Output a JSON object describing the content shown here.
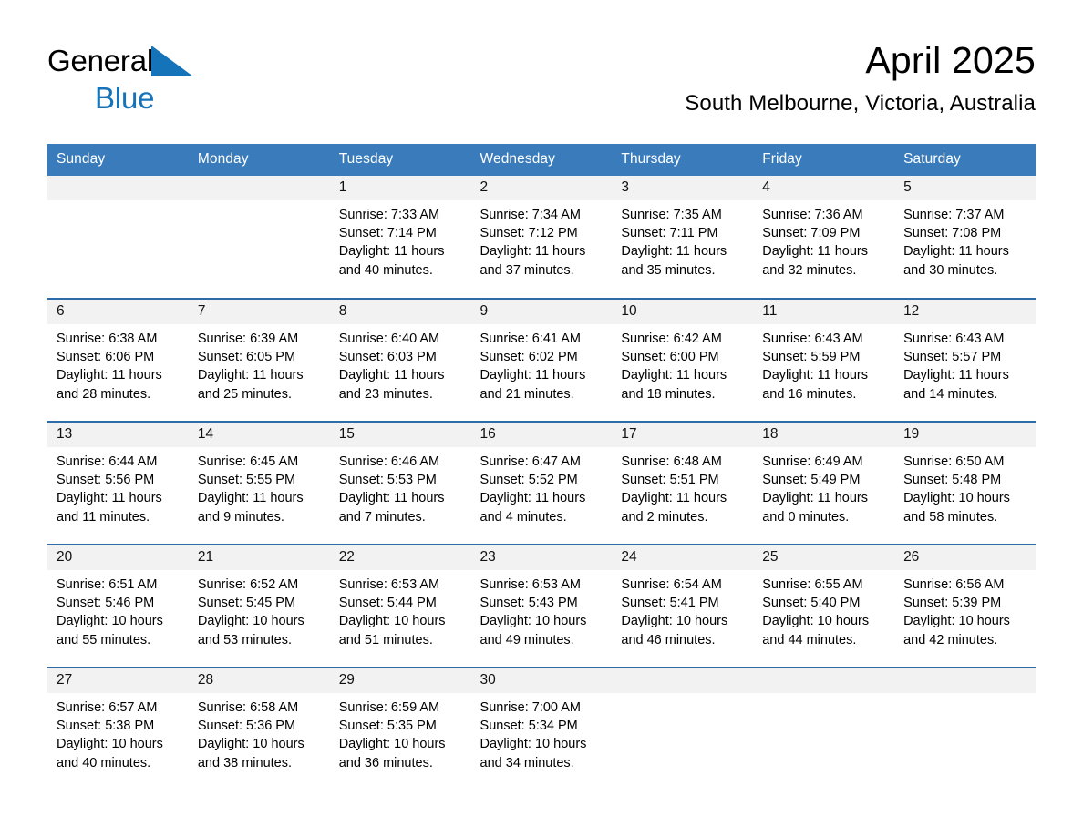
{
  "brand": {
    "name_part1": "General",
    "name_part2": "Blue",
    "triangle_color": "#1573b9"
  },
  "header": {
    "title": "April 2025",
    "subtitle": "South Melbourne, Victoria, Australia"
  },
  "theme": {
    "header_row_bg": "#3a7cbb",
    "week_divider": "#2c6ca8",
    "daynum_bg": "#f2f2f2",
    "text": "#000000"
  },
  "weekday_headers": [
    "Sunday",
    "Monday",
    "Tuesday",
    "Wednesday",
    "Thursday",
    "Friday",
    "Saturday"
  ],
  "labels": {
    "sunrise_prefix": "Sunrise:",
    "sunset_prefix": "Sunset:",
    "daylight_prefix": "Daylight:"
  },
  "weeks": [
    [
      {
        "blank": true,
        "day": ""
      },
      {
        "blank": true,
        "day": ""
      },
      {
        "blank": false,
        "day": "1",
        "sunrise": "Sunrise: 7:33 AM",
        "sunset": "Sunset: 7:14 PM",
        "daylight_l1": "Daylight: 11 hours",
        "daylight_l2": "and 40 minutes."
      },
      {
        "blank": false,
        "day": "2",
        "sunrise": "Sunrise: 7:34 AM",
        "sunset": "Sunset: 7:12 PM",
        "daylight_l1": "Daylight: 11 hours",
        "daylight_l2": "and 37 minutes."
      },
      {
        "blank": false,
        "day": "3",
        "sunrise": "Sunrise: 7:35 AM",
        "sunset": "Sunset: 7:11 PM",
        "daylight_l1": "Daylight: 11 hours",
        "daylight_l2": "and 35 minutes."
      },
      {
        "blank": false,
        "day": "4",
        "sunrise": "Sunrise: 7:36 AM",
        "sunset": "Sunset: 7:09 PM",
        "daylight_l1": "Daylight: 11 hours",
        "daylight_l2": "and 32 minutes."
      },
      {
        "blank": false,
        "day": "5",
        "sunrise": "Sunrise: 7:37 AM",
        "sunset": "Sunset: 7:08 PM",
        "daylight_l1": "Daylight: 11 hours",
        "daylight_l2": "and 30 minutes."
      }
    ],
    [
      {
        "blank": false,
        "day": "6",
        "sunrise": "Sunrise: 6:38 AM",
        "sunset": "Sunset: 6:06 PM",
        "daylight_l1": "Daylight: 11 hours",
        "daylight_l2": "and 28 minutes."
      },
      {
        "blank": false,
        "day": "7",
        "sunrise": "Sunrise: 6:39 AM",
        "sunset": "Sunset: 6:05 PM",
        "daylight_l1": "Daylight: 11 hours",
        "daylight_l2": "and 25 minutes."
      },
      {
        "blank": false,
        "day": "8",
        "sunrise": "Sunrise: 6:40 AM",
        "sunset": "Sunset: 6:03 PM",
        "daylight_l1": "Daylight: 11 hours",
        "daylight_l2": "and 23 minutes."
      },
      {
        "blank": false,
        "day": "9",
        "sunrise": "Sunrise: 6:41 AM",
        "sunset": "Sunset: 6:02 PM",
        "daylight_l1": "Daylight: 11 hours",
        "daylight_l2": "and 21 minutes."
      },
      {
        "blank": false,
        "day": "10",
        "sunrise": "Sunrise: 6:42 AM",
        "sunset": "Sunset: 6:00 PM",
        "daylight_l1": "Daylight: 11 hours",
        "daylight_l2": "and 18 minutes."
      },
      {
        "blank": false,
        "day": "11",
        "sunrise": "Sunrise: 6:43 AM",
        "sunset": "Sunset: 5:59 PM",
        "daylight_l1": "Daylight: 11 hours",
        "daylight_l2": "and 16 minutes."
      },
      {
        "blank": false,
        "day": "12",
        "sunrise": "Sunrise: 6:43 AM",
        "sunset": "Sunset: 5:57 PM",
        "daylight_l1": "Daylight: 11 hours",
        "daylight_l2": "and 14 minutes."
      }
    ],
    [
      {
        "blank": false,
        "day": "13",
        "sunrise": "Sunrise: 6:44 AM",
        "sunset": "Sunset: 5:56 PM",
        "daylight_l1": "Daylight: 11 hours",
        "daylight_l2": "and 11 minutes."
      },
      {
        "blank": false,
        "day": "14",
        "sunrise": "Sunrise: 6:45 AM",
        "sunset": "Sunset: 5:55 PM",
        "daylight_l1": "Daylight: 11 hours",
        "daylight_l2": "and 9 minutes."
      },
      {
        "blank": false,
        "day": "15",
        "sunrise": "Sunrise: 6:46 AM",
        "sunset": "Sunset: 5:53 PM",
        "daylight_l1": "Daylight: 11 hours",
        "daylight_l2": "and 7 minutes."
      },
      {
        "blank": false,
        "day": "16",
        "sunrise": "Sunrise: 6:47 AM",
        "sunset": "Sunset: 5:52 PM",
        "daylight_l1": "Daylight: 11 hours",
        "daylight_l2": "and 4 minutes."
      },
      {
        "blank": false,
        "day": "17",
        "sunrise": "Sunrise: 6:48 AM",
        "sunset": "Sunset: 5:51 PM",
        "daylight_l1": "Daylight: 11 hours",
        "daylight_l2": "and 2 minutes."
      },
      {
        "blank": false,
        "day": "18",
        "sunrise": "Sunrise: 6:49 AM",
        "sunset": "Sunset: 5:49 PM",
        "daylight_l1": "Daylight: 11 hours",
        "daylight_l2": "and 0 minutes."
      },
      {
        "blank": false,
        "day": "19",
        "sunrise": "Sunrise: 6:50 AM",
        "sunset": "Sunset: 5:48 PM",
        "daylight_l1": "Daylight: 10 hours",
        "daylight_l2": "and 58 minutes."
      }
    ],
    [
      {
        "blank": false,
        "day": "20",
        "sunrise": "Sunrise: 6:51 AM",
        "sunset": "Sunset: 5:46 PM",
        "daylight_l1": "Daylight: 10 hours",
        "daylight_l2": "and 55 minutes."
      },
      {
        "blank": false,
        "day": "21",
        "sunrise": "Sunrise: 6:52 AM",
        "sunset": "Sunset: 5:45 PM",
        "daylight_l1": "Daylight: 10 hours",
        "daylight_l2": "and 53 minutes."
      },
      {
        "blank": false,
        "day": "22",
        "sunrise": "Sunrise: 6:53 AM",
        "sunset": "Sunset: 5:44 PM",
        "daylight_l1": "Daylight: 10 hours",
        "daylight_l2": "and 51 minutes."
      },
      {
        "blank": false,
        "day": "23",
        "sunrise": "Sunrise: 6:53 AM",
        "sunset": "Sunset: 5:43 PM",
        "daylight_l1": "Daylight: 10 hours",
        "daylight_l2": "and 49 minutes."
      },
      {
        "blank": false,
        "day": "24",
        "sunrise": "Sunrise: 6:54 AM",
        "sunset": "Sunset: 5:41 PM",
        "daylight_l1": "Daylight: 10 hours",
        "daylight_l2": "and 46 minutes."
      },
      {
        "blank": false,
        "day": "25",
        "sunrise": "Sunrise: 6:55 AM",
        "sunset": "Sunset: 5:40 PM",
        "daylight_l1": "Daylight: 10 hours",
        "daylight_l2": "and 44 minutes."
      },
      {
        "blank": false,
        "day": "26",
        "sunrise": "Sunrise: 6:56 AM",
        "sunset": "Sunset: 5:39 PM",
        "daylight_l1": "Daylight: 10 hours",
        "daylight_l2": "and 42 minutes."
      }
    ],
    [
      {
        "blank": false,
        "day": "27",
        "sunrise": "Sunrise: 6:57 AM",
        "sunset": "Sunset: 5:38 PM",
        "daylight_l1": "Daylight: 10 hours",
        "daylight_l2": "and 40 minutes."
      },
      {
        "blank": false,
        "day": "28",
        "sunrise": "Sunrise: 6:58 AM",
        "sunset": "Sunset: 5:36 PM",
        "daylight_l1": "Daylight: 10 hours",
        "daylight_l2": "and 38 minutes."
      },
      {
        "blank": false,
        "day": "29",
        "sunrise": "Sunrise: 6:59 AM",
        "sunset": "Sunset: 5:35 PM",
        "daylight_l1": "Daylight: 10 hours",
        "daylight_l2": "and 36 minutes."
      },
      {
        "blank": false,
        "day": "30",
        "sunrise": "Sunrise: 7:00 AM",
        "sunset": "Sunset: 5:34 PM",
        "daylight_l1": "Daylight: 10 hours",
        "daylight_l2": "and 34 minutes."
      },
      {
        "blank": true,
        "day": ""
      },
      {
        "blank": true,
        "day": ""
      },
      {
        "blank": true,
        "day": ""
      }
    ]
  ]
}
